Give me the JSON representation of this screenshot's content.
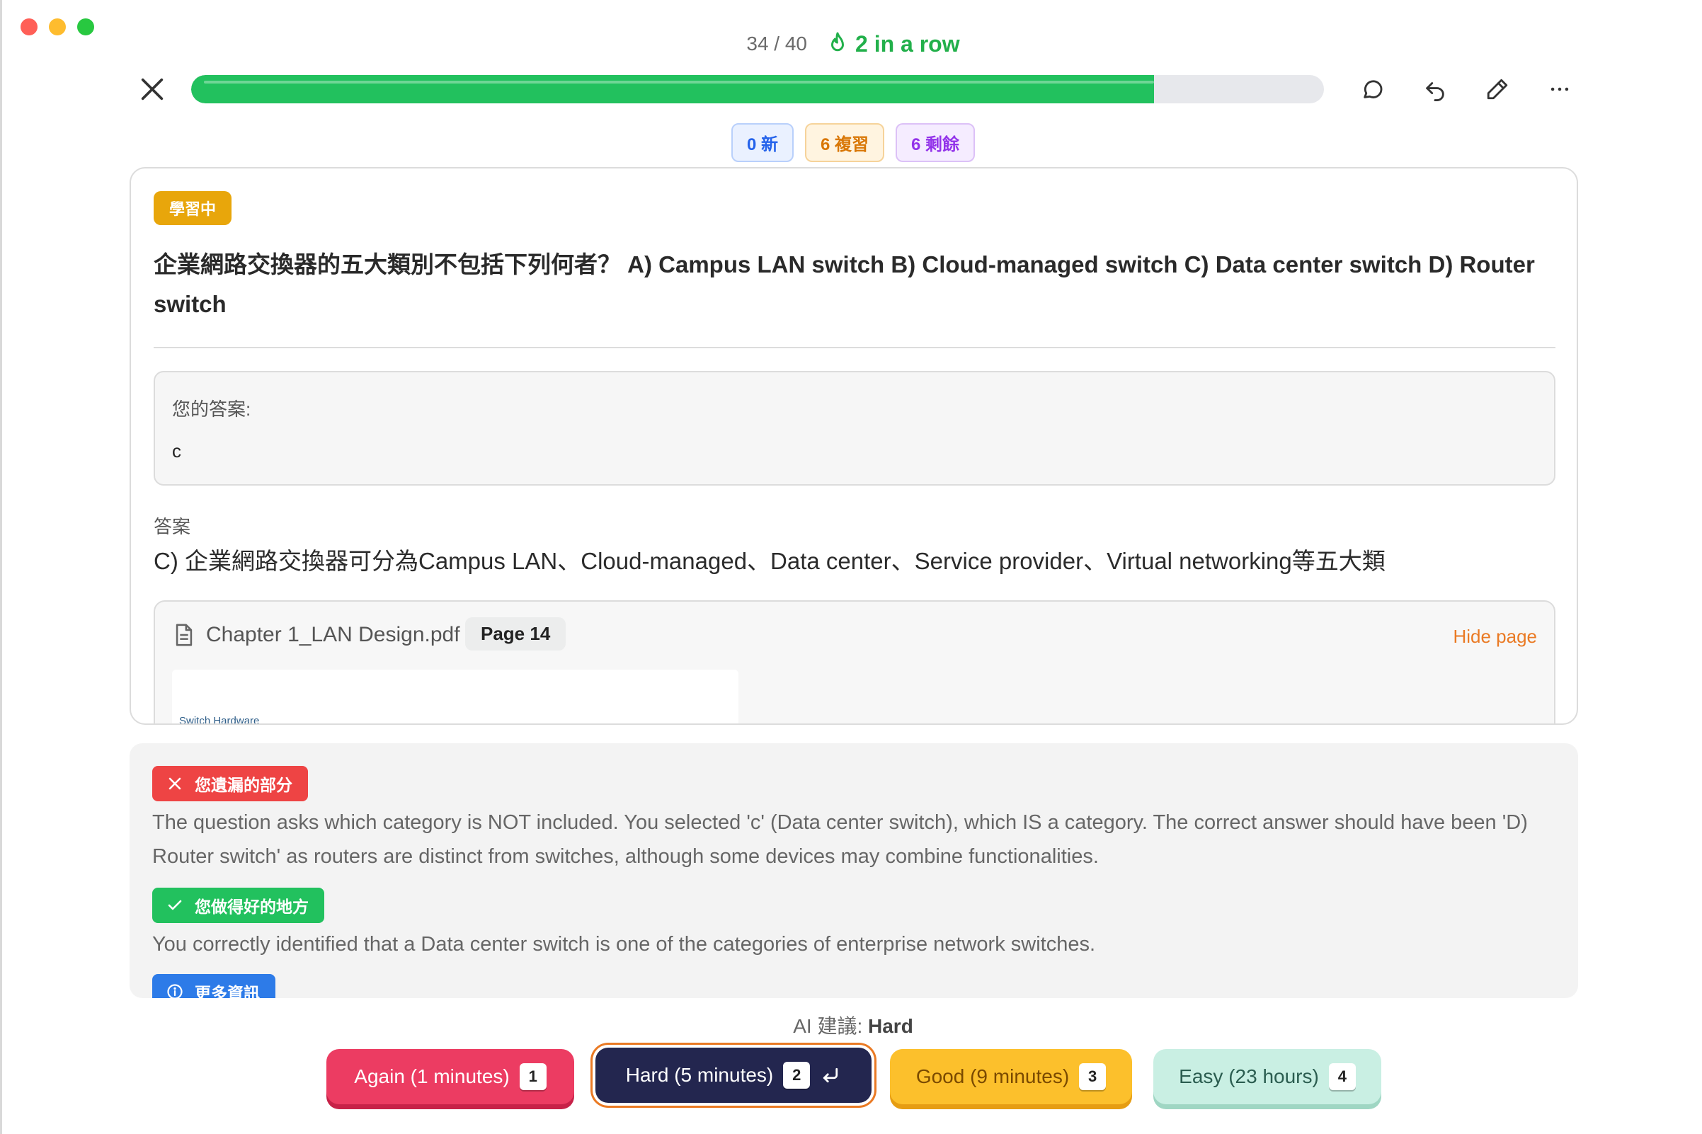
{
  "header": {
    "counter": "34 / 40",
    "streak": "2 in a row",
    "progress_fraction": 0.85
  },
  "chips": {
    "new": "0 新",
    "review": "6 複習",
    "remaining": "6 剩餘"
  },
  "card": {
    "status_badge": "學習中",
    "question": "企業網路交換器的五大類別不包括下列何者？ A) Campus LAN switch B) Cloud-managed switch C) Data center switch D) Router switch",
    "my_answer_label": "您的答案:",
    "my_answer_value": "c",
    "answer_label": "答案",
    "answer_text": "C) 企業網路交換器可分為Campus LAN、Cloud-managed、Data center、Service provider、Virtual networking等五大類",
    "source": {
      "file_name": "Chapter 1_LAN Design.pdf",
      "page": "Page 14",
      "hide_label": "Hide page",
      "preview_text": "Switch Hardware"
    }
  },
  "feedback": {
    "missed_label": "您遺漏的部分",
    "missed_text": "The question asks which category is NOT included. You selected 'c' (Data center switch), which IS a category. The correct answer should have been 'D) Router switch' as routers are distinct from switches, although some devices may combine functionalities.",
    "good_label": "您做得好的地方",
    "good_text": "You correctly identified that a Data center switch is one of the categories of enterprise network switches.",
    "more_label": "更多資訊"
  },
  "ai_suggestion": {
    "label": "AI 建議:",
    "value": "Hard"
  },
  "grade_buttons": {
    "again": {
      "label": "Again (1 minutes)",
      "key": "1"
    },
    "hard": {
      "label": "Hard (5 minutes)",
      "key": "2"
    },
    "good": {
      "label": "Good (9 minutes)",
      "key": "3"
    },
    "easy": {
      "label": "Easy (23 hours)",
      "key": "4"
    }
  },
  "colors": {
    "progress": "#22c15e",
    "streak": "#22b04b",
    "again": "#ec3c62",
    "hard": "#23264f",
    "good": "#fcc02c",
    "easy": "#c9efe3",
    "focus_ring": "#ea7a24"
  },
  "icons": [
    "close-icon",
    "flame-icon",
    "comment-icon",
    "undo-icon",
    "edit-icon",
    "more-icon",
    "document-icon",
    "x-icon",
    "check-icon",
    "info-icon",
    "enter-icon"
  ]
}
